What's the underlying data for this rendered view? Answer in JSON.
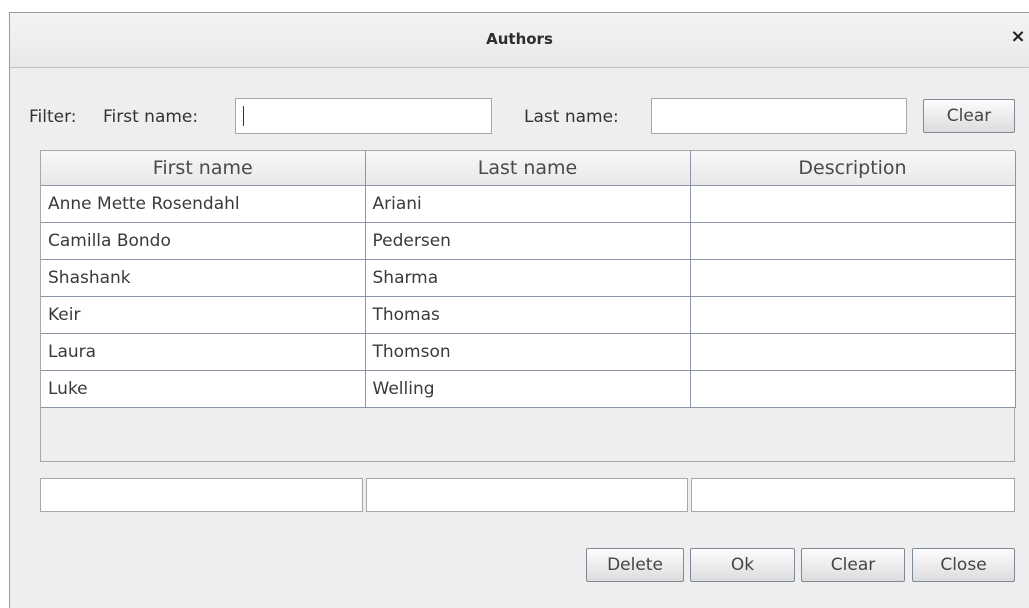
{
  "window": {
    "title": "Authors",
    "close_glyph": "×"
  },
  "filter": {
    "label": "Filter:",
    "first_name_label": "First name:",
    "first_name_value": "",
    "last_name_label": "Last name:",
    "last_name_value": "",
    "clear_label": "Clear"
  },
  "table": {
    "columns": [
      "First name",
      "Last name",
      "Description"
    ],
    "rows": [
      [
        "Anne Mette Rosendahl",
        "Ariani",
        ""
      ],
      [
        "Camilla Bondo",
        "Pedersen",
        ""
      ],
      [
        "Shashank",
        "Sharma",
        ""
      ],
      [
        "Keir",
        "Thomas",
        ""
      ],
      [
        "Laura",
        "Thomson",
        ""
      ],
      [
        "Luke",
        "Welling",
        ""
      ]
    ]
  },
  "edit": {
    "first_name": "",
    "last_name": "",
    "description": ""
  },
  "buttons": {
    "delete": "Delete",
    "ok": "Ok",
    "clear": "Clear",
    "close": "Close"
  }
}
